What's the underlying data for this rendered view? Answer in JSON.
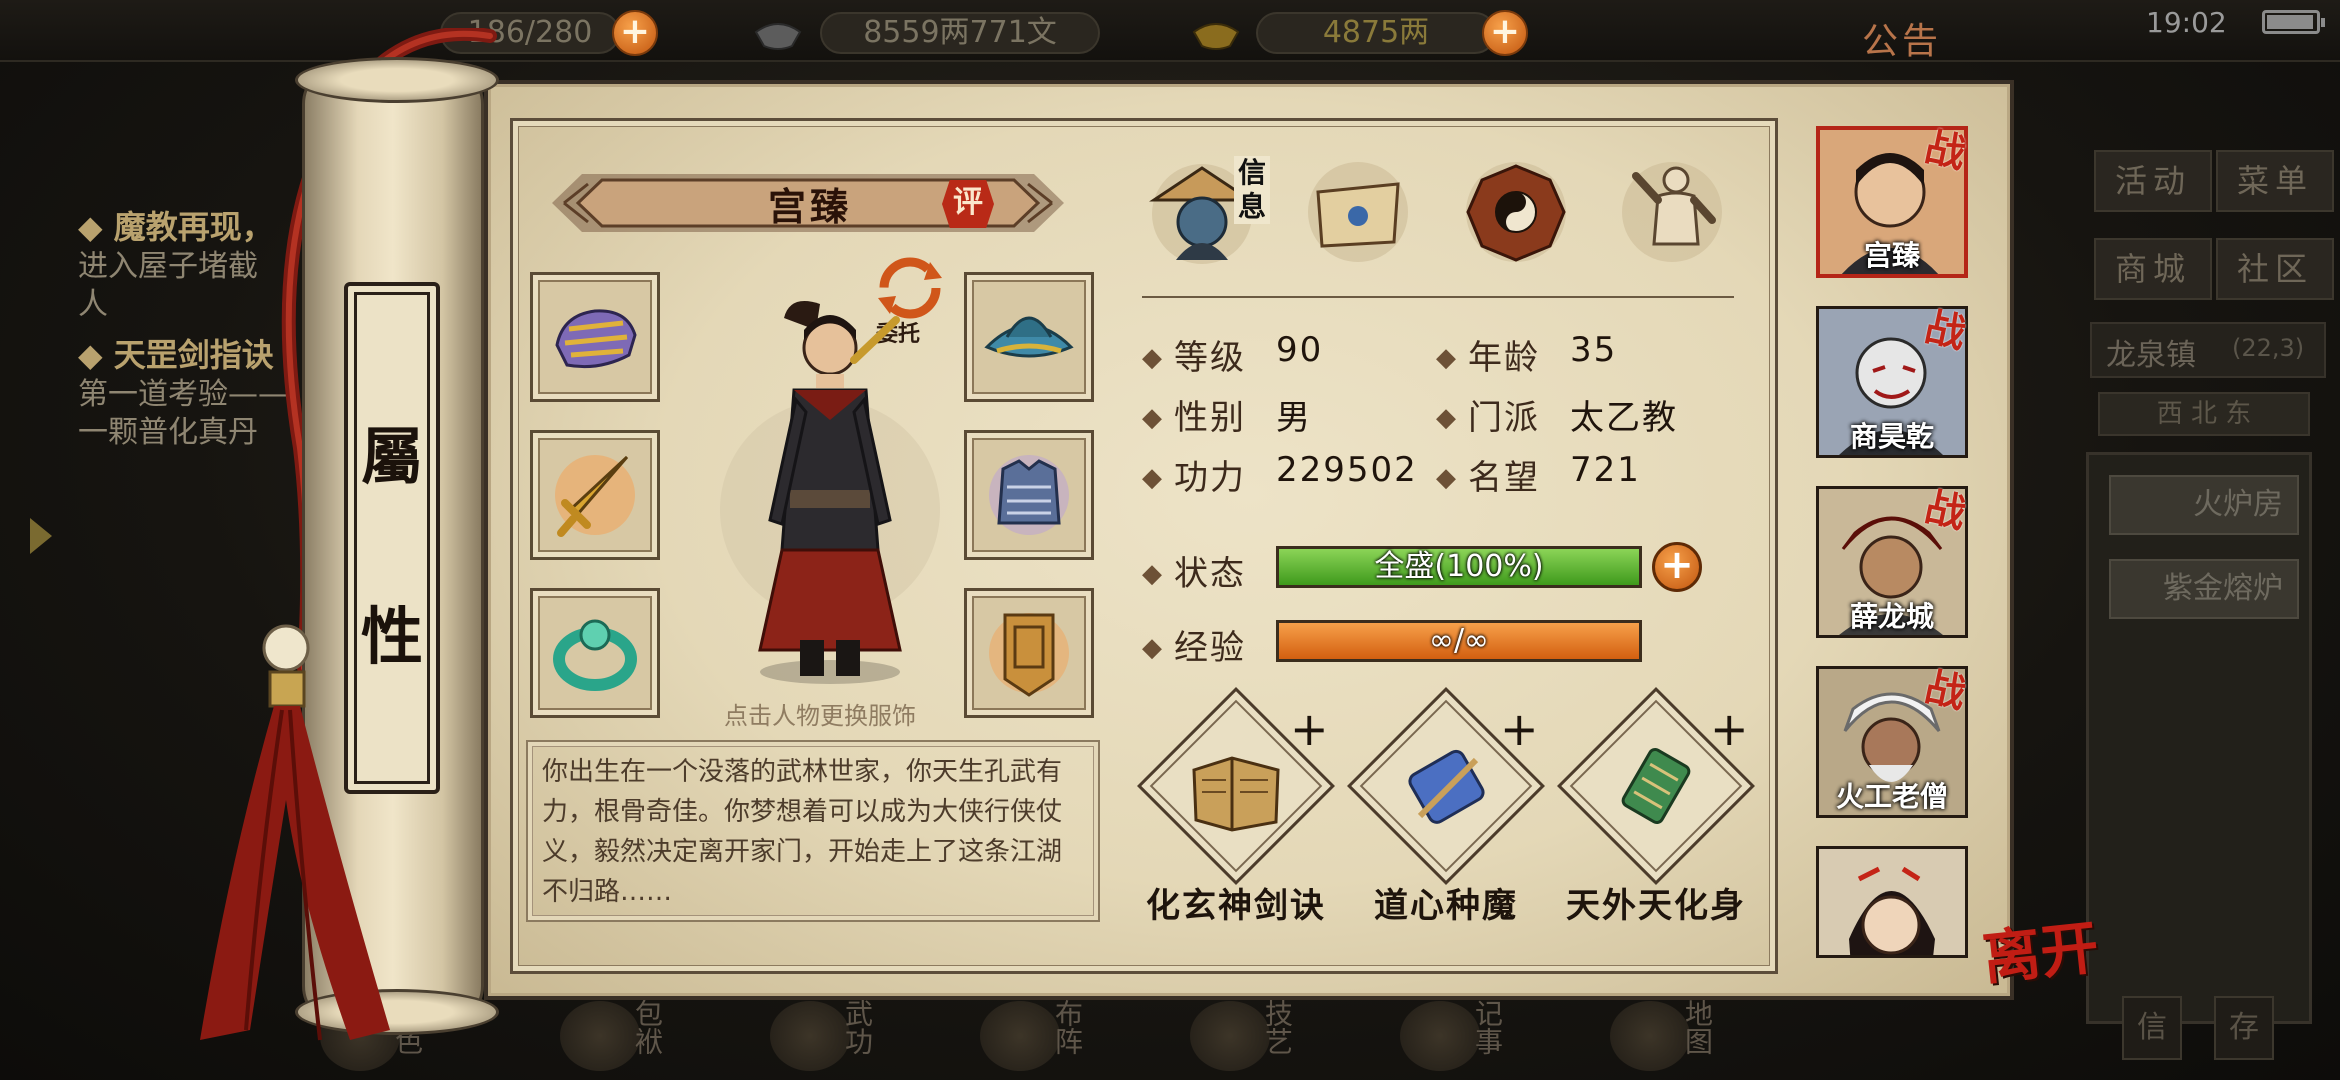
{
  "status_bar": {
    "time": "19:02"
  },
  "top_bar": {
    "stamina": "186/280",
    "silver": "8559两771文",
    "gold": "4875两",
    "notice_label": "公告"
  },
  "quests": [
    {
      "title": "魔教再现，",
      "desc": [
        "进入屋子堵截",
        "人"
      ]
    },
    {
      "title": "天罡剑指诀",
      "desc": [
        "第一道考验——",
        "一颗普化真丹"
      ]
    }
  ],
  "right_menu": {
    "buttons": [
      "活动",
      "菜单",
      "商城",
      "社区"
    ],
    "location": "龙泉镇",
    "coords": "(22,3)",
    "direction": "西  北  东",
    "panel_buttons": [
      "火炉房",
      "紫金熔炉"
    ]
  },
  "bottom_nav": [
    "角色",
    "包袱",
    "武功",
    "布阵",
    "技艺",
    "记事",
    "地图"
  ],
  "bottom_corner": [
    "信",
    "存"
  ],
  "scroll_title": [
    "屬",
    "性"
  ],
  "character": {
    "name": "宫臻",
    "rate_label": "评",
    "entrust_label": "委托",
    "change_outfit_hint": "点击人物更换服饰",
    "bio": "你出生在一个没落的武林世家，你天生孔武有力，根骨奇佳。你梦想着可以成为大侠行侠仗义，毅然决定离开家门，开始走上了这条江湖不归路……"
  },
  "info_tab_label": "信息",
  "stats": {
    "level_label": "等级",
    "level": "90",
    "age_label": "年龄",
    "age": "35",
    "gender_label": "性别",
    "gender": "男",
    "sect_label": "门派",
    "sect": "太乙教",
    "power_label": "功力",
    "power": "229502",
    "fame_label": "名望",
    "fame": "721",
    "state_label": "状态",
    "state_text": "全盛(100%)",
    "state_fraction": 1.0,
    "exp_label": "经验",
    "exp_text": "∞/∞",
    "exp_fraction": 1.0
  },
  "skills": [
    {
      "name": "化玄神剑诀",
      "add": "+"
    },
    {
      "name": "道心种魔",
      "add": "+"
    },
    {
      "name": "天外天化身",
      "add": "+"
    }
  ],
  "team": [
    {
      "name": "宫臻",
      "battle": "战"
    },
    {
      "name": "商昊乾",
      "battle": "战"
    },
    {
      "name": "薛龙城",
      "battle": "战"
    },
    {
      "name": "火工老僧",
      "battle": "战"
    },
    {
      "name": "",
      "battle": ""
    }
  ],
  "leave_label": "离开",
  "colors": {
    "state_bar": "#56b52c",
    "exp_bar": "#e7761a",
    "accent_red": "#c11d14"
  }
}
